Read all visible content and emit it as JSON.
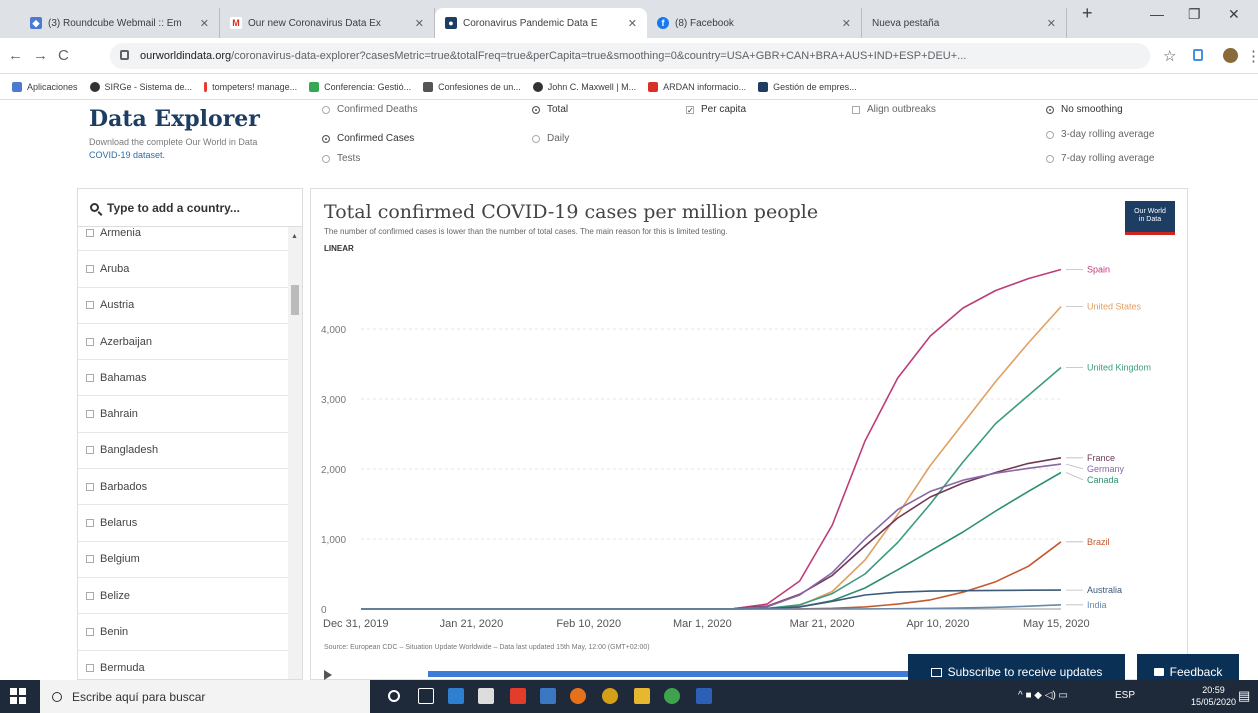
{
  "browser": {
    "tabs": [
      {
        "title": "(3) Roundcube Webmail :: Em",
        "color": "#4a7bd0",
        "glyph": "◆"
      },
      {
        "title": "Our new Coronavirus Data Ex",
        "color": "#d93025",
        "glyph": "M"
      },
      {
        "title": "Coronavirus Pandemic Data E",
        "color": "#1d3d63",
        "glyph": "●"
      },
      {
        "title": "(8) Facebook",
        "color": "#1877f2",
        "glyph": "f"
      },
      {
        "title": "Nueva pestaña",
        "color": "#dee1e6",
        "glyph": ""
      }
    ],
    "new_tab": "+",
    "url_host": "ourworldindata.org",
    "url_path": "/coronavirus-data-explorer?casesMetric=true&totalFreq=true&perCapita=true&smoothing=0&country=USA+GBR+CAN+BRA+AUS+IND+ESP+DEU+...",
    "bookmarks": [
      {
        "label": "Aplicaciones",
        "color": "#4a7bd0"
      },
      {
        "label": "SIRGe - Sistema de...",
        "color": "#333333"
      },
      {
        "label": "tompeters! manage...",
        "color": "#e63b2e"
      },
      {
        "label": "Conferencia: Gestió...",
        "color": "#34a853"
      },
      {
        "label": "Confesiones de un...",
        "color": "#555555"
      },
      {
        "label": "John C. Maxwell | M...",
        "color": "#333333"
      },
      {
        "label": "ARDAN informacio...",
        "color": "#d93025"
      },
      {
        "label": "Gestión de empres...",
        "color": "#1d3d63"
      }
    ]
  },
  "explorer": {
    "title": "Data Explorer",
    "subtitle_pre": "Download the complete Our World in Data ",
    "subtitle_link": "COVID-19 dataset.",
    "options": {
      "metric": [
        {
          "label": "Confirmed Deaths",
          "on": false
        },
        {
          "label": "Confirmed Cases",
          "on": true
        },
        {
          "label": "Tests",
          "on": false
        }
      ],
      "freq": [
        {
          "label": "Total",
          "on": true
        },
        {
          "label": "Daily",
          "on": false
        }
      ],
      "per_capita": {
        "label": "Per capita",
        "on": true
      },
      "align": {
        "label": "Align outbreaks",
        "on": false
      },
      "smoothing": [
        {
          "label": "No smoothing",
          "on": true
        },
        {
          "label": "3-day rolling average",
          "on": false
        },
        {
          "label": "7-day rolling average",
          "on": false
        }
      ]
    },
    "search_placeholder": "Type to add a country...",
    "countries": [
      "Armenia",
      "Aruba",
      "Austria",
      "Azerbaijan",
      "Bahamas",
      "Bahrain",
      "Bangladesh",
      "Barbados",
      "Belarus",
      "Belgium",
      "Belize",
      "Benin",
      "Bermuda"
    ],
    "subscribe_label": "Subscribe to receive updates",
    "feedback_label": "Feedback"
  },
  "chart_data": {
    "type": "line",
    "title": "Total confirmed COVID-19 cases per million people",
    "subtitle": "The number of confirmed cases is lower than the number of total cases. The main reason for this is limited testing.",
    "scale_label": "LINEAR",
    "ylim": [
      0,
      5000
    ],
    "yticks": [
      0,
      1000,
      2000,
      3000,
      4000
    ],
    "ytick_labels": [
      "0",
      "1,000",
      "2,000",
      "3,000",
      "4,000"
    ],
    "xticks": [
      "Dec 31, 2019",
      "Jan 21, 2020",
      "Feb 10, 2020",
      "Mar 1, 2020",
      "Mar 21, 2020",
      "Apr 10, 2020",
      "May 15, 2020"
    ],
    "x": [
      "Mar 5",
      "Mar 12",
      "Mar 19",
      "Mar 26",
      "Apr 2",
      "Apr 9",
      "Apr 16",
      "Apr 23",
      "Apr 30",
      "May 7",
      "May 14"
    ],
    "series": [
      {
        "name": "Spain",
        "color": "#bd3c7a",
        "values": [
          5,
          70,
          400,
          1200,
          2400,
          3300,
          3900,
          4300,
          4550,
          4720,
          4850
        ]
      },
      {
        "name": "United States",
        "color": "#e0a062",
        "values": [
          1,
          5,
          50,
          250,
          700,
          1350,
          2050,
          2650,
          3250,
          3800,
          4320
        ]
      },
      {
        "name": "United Kingdom",
        "color": "#3e9b82",
        "values": [
          1,
          8,
          60,
          220,
          500,
          950,
          1500,
          2100,
          2650,
          3050,
          3450
        ]
      },
      {
        "name": "France",
        "color": "#6e3a55",
        "values": [
          5,
          40,
          210,
          480,
          900,
          1300,
          1600,
          1800,
          1950,
          2080,
          2160
        ]
      },
      {
        "name": "Germany",
        "color": "#8a66a6",
        "values": [
          3,
          30,
          200,
          520,
          1000,
          1420,
          1680,
          1840,
          1940,
          2010,
          2070
        ]
      },
      {
        "name": "Canada",
        "color": "#2d8f72",
        "values": [
          1,
          4,
          30,
          120,
          300,
          560,
          830,
          1100,
          1400,
          1680,
          1950
        ]
      },
      {
        "name": "Brazil",
        "color": "#c35a30",
        "values": [
          0,
          0,
          2,
          10,
          30,
          70,
          130,
          240,
          390,
          610,
          960
        ]
      },
      {
        "name": "Australia",
        "color": "#3d5a7a",
        "values": [
          1,
          5,
          30,
          110,
          200,
          240,
          255,
          262,
          265,
          268,
          270
        ]
      },
      {
        "name": "India",
        "color": "#6688aa",
        "values": [
          0,
          0,
          0,
          0,
          1,
          4,
          9,
          16,
          25,
          40,
          60
        ]
      }
    ],
    "source": "Source: European CDC – Situation Update Worldwide – Data last updated 15th May, 12:00 (GMT+02:00)"
  },
  "taskbar": {
    "search_placeholder": "Escribe aquí para buscar",
    "language": "ESP",
    "time": "20:59",
    "date": "15/05/2020"
  }
}
